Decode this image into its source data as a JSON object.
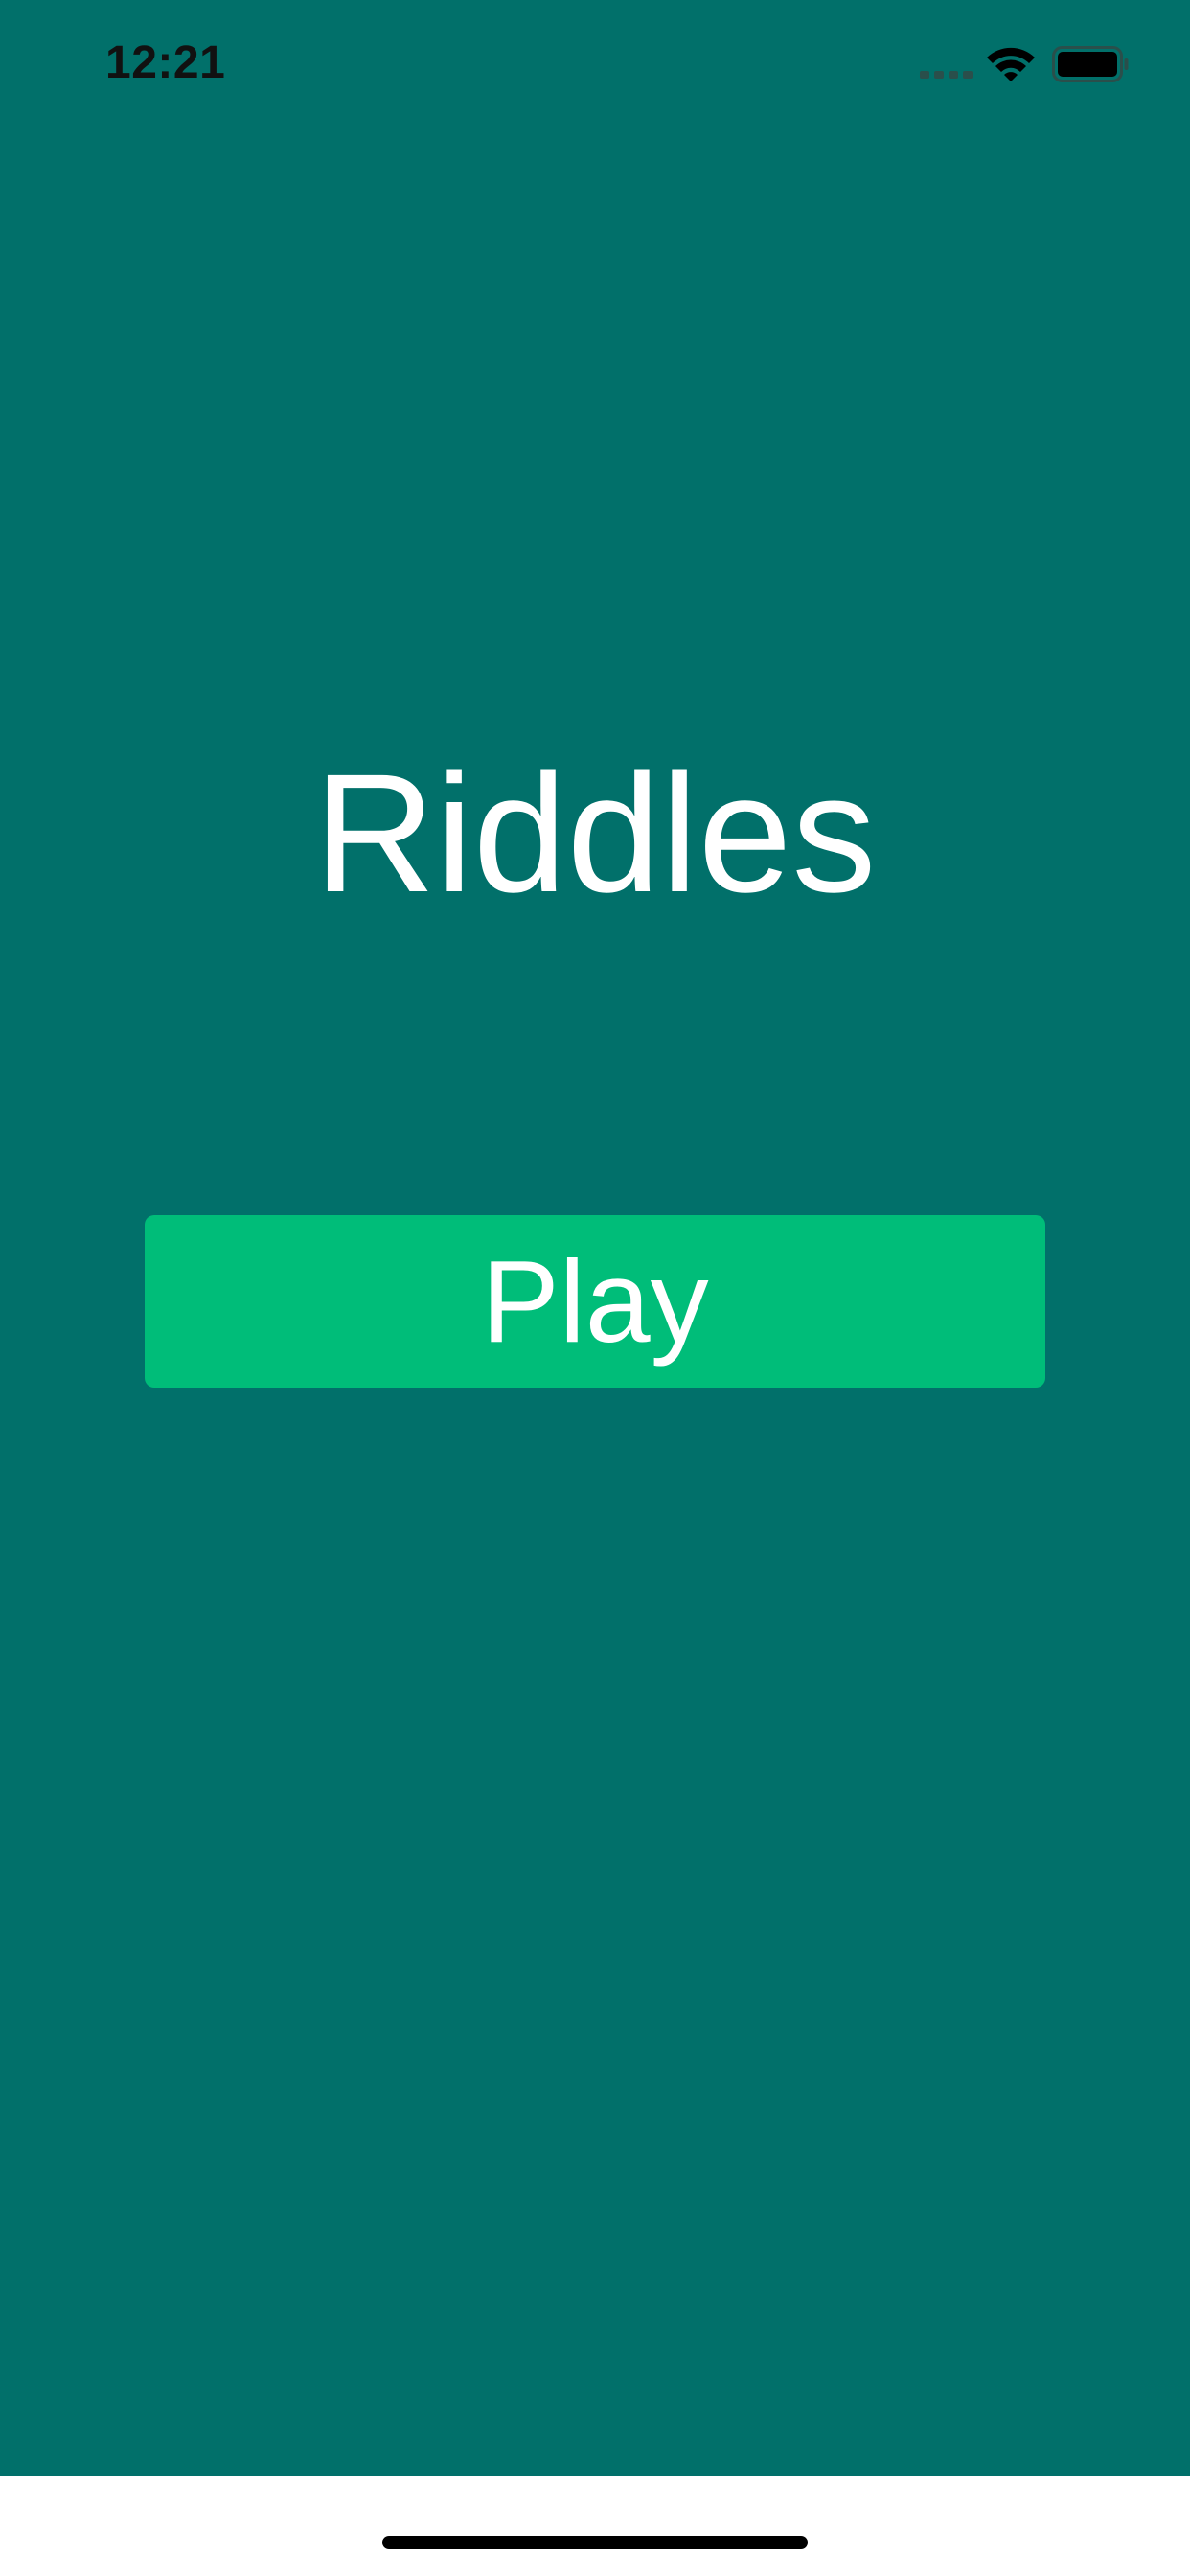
{
  "status_bar": {
    "time": "12:21",
    "icons": [
      "signal-icon",
      "wifi-icon",
      "battery-icon"
    ]
  },
  "main": {
    "title": "Riddles",
    "play_label": "Play"
  },
  "colors": {
    "background": "#01706A",
    "button": "#00BD79",
    "text": "#FFFFFF",
    "bottom_bar": "#FFFFFF",
    "home_indicator": "#000000"
  }
}
